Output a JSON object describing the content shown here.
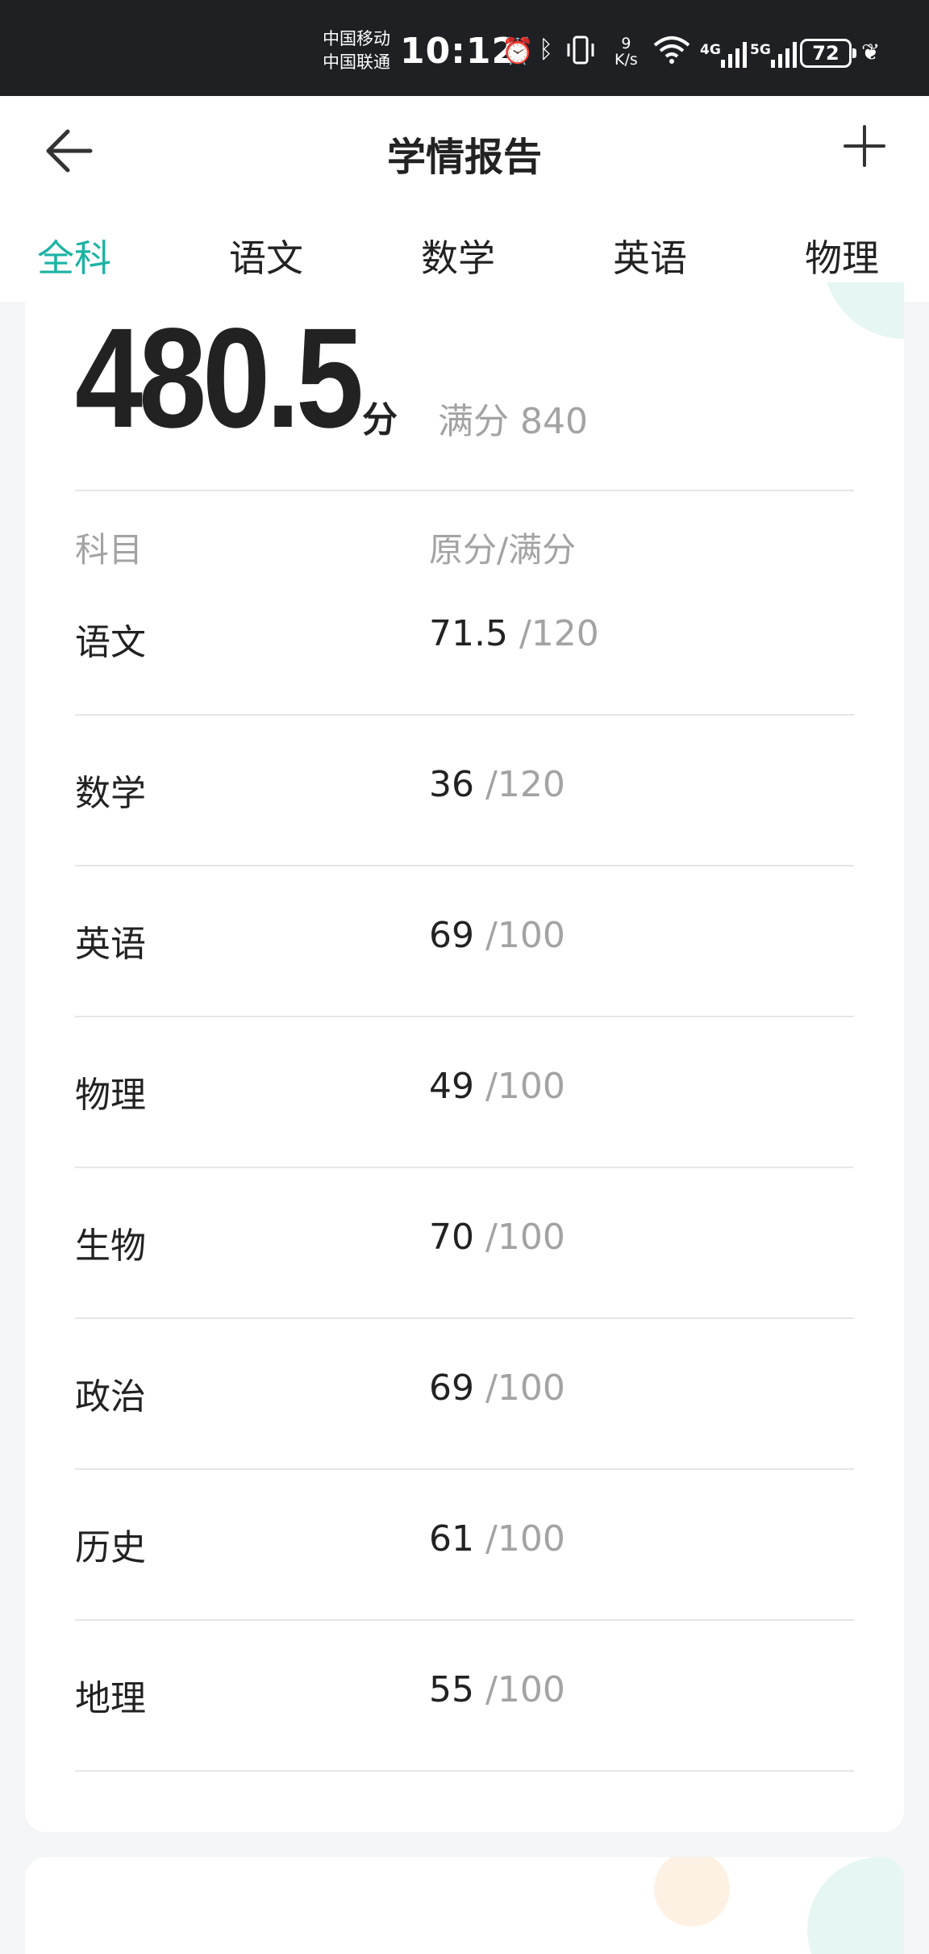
{
  "status_bar": {
    "carrier1": "中国移动",
    "carrier2": "中国联通",
    "time": "10:12",
    "net_speed_value": "9",
    "net_speed_unit": "K/s",
    "net1": "4G",
    "net2": "5G",
    "battery": "72"
  },
  "header": {
    "title": "学情报告"
  },
  "tabs": [
    "全科",
    "语文",
    "数学",
    "英语",
    "物理"
  ],
  "active_tab": 0,
  "summary": {
    "total": "480.5",
    "unit": "分",
    "full_label": "满分 840"
  },
  "table": {
    "col_subject": "科目",
    "col_score": "原分/满分",
    "rows": [
      {
        "subject": "语文",
        "score": "71.5",
        "full": "/120"
      },
      {
        "subject": "数学",
        "score": "36",
        "full": "/120"
      },
      {
        "subject": "英语",
        "score": "69",
        "full": "/100"
      },
      {
        "subject": "物理",
        "score": "49",
        "full": "/100"
      },
      {
        "subject": "生物",
        "score": "70",
        "full": "/100"
      },
      {
        "subject": "政治",
        "score": "69",
        "full": "/100"
      },
      {
        "subject": "历史",
        "score": "61",
        "full": "/100"
      },
      {
        "subject": "地理",
        "score": "55",
        "full": "/100"
      }
    ]
  },
  "colors": {
    "accent": "#1bb3a4",
    "status_bar_bg": "#1e2023",
    "muted_text": "#a3a3a3"
  }
}
